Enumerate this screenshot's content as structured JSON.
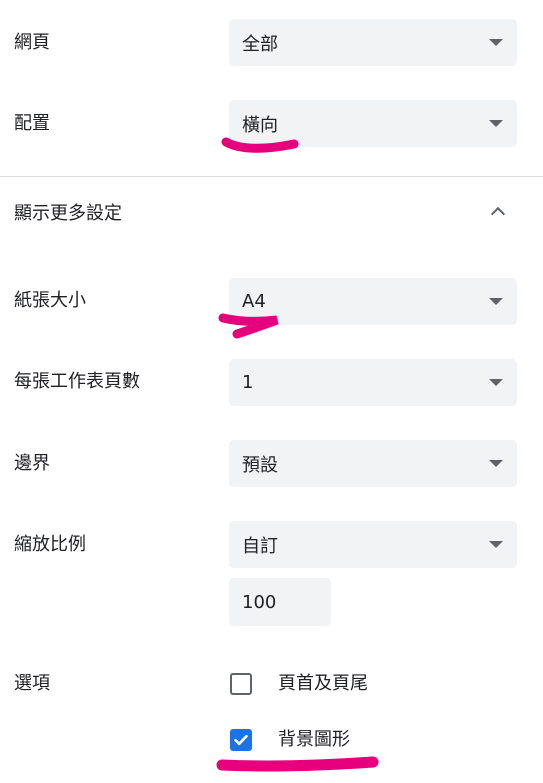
{
  "settings": {
    "pages": {
      "label": "網頁",
      "value": "全部"
    },
    "layout": {
      "label": "配置",
      "value": "橫向"
    },
    "more_settings": {
      "label": "顯示更多設定"
    },
    "paper_size": {
      "label": "紙張大小",
      "value": "A4"
    },
    "pages_per_sheet": {
      "label": "每張工作表頁數",
      "value": "1"
    },
    "margins": {
      "label": "邊界",
      "value": "預設"
    },
    "scale": {
      "label": "縮放比例",
      "value": "自訂",
      "custom_value": "100"
    },
    "options": {
      "label": "選項",
      "headers_footers": {
        "label": "頁首及頁尾",
        "checked": false
      },
      "background_graphics": {
        "label": "背景圖形",
        "checked": true
      }
    }
  },
  "colors": {
    "select_bg": "#f1f3f4",
    "checkbox_checked": "#1a73e8",
    "annotation_highlight": "#e6007e"
  },
  "icons": {
    "dropdown": "caret-down-icon",
    "collapse": "chevron-up-icon",
    "checkmark": "checkmark-icon"
  }
}
